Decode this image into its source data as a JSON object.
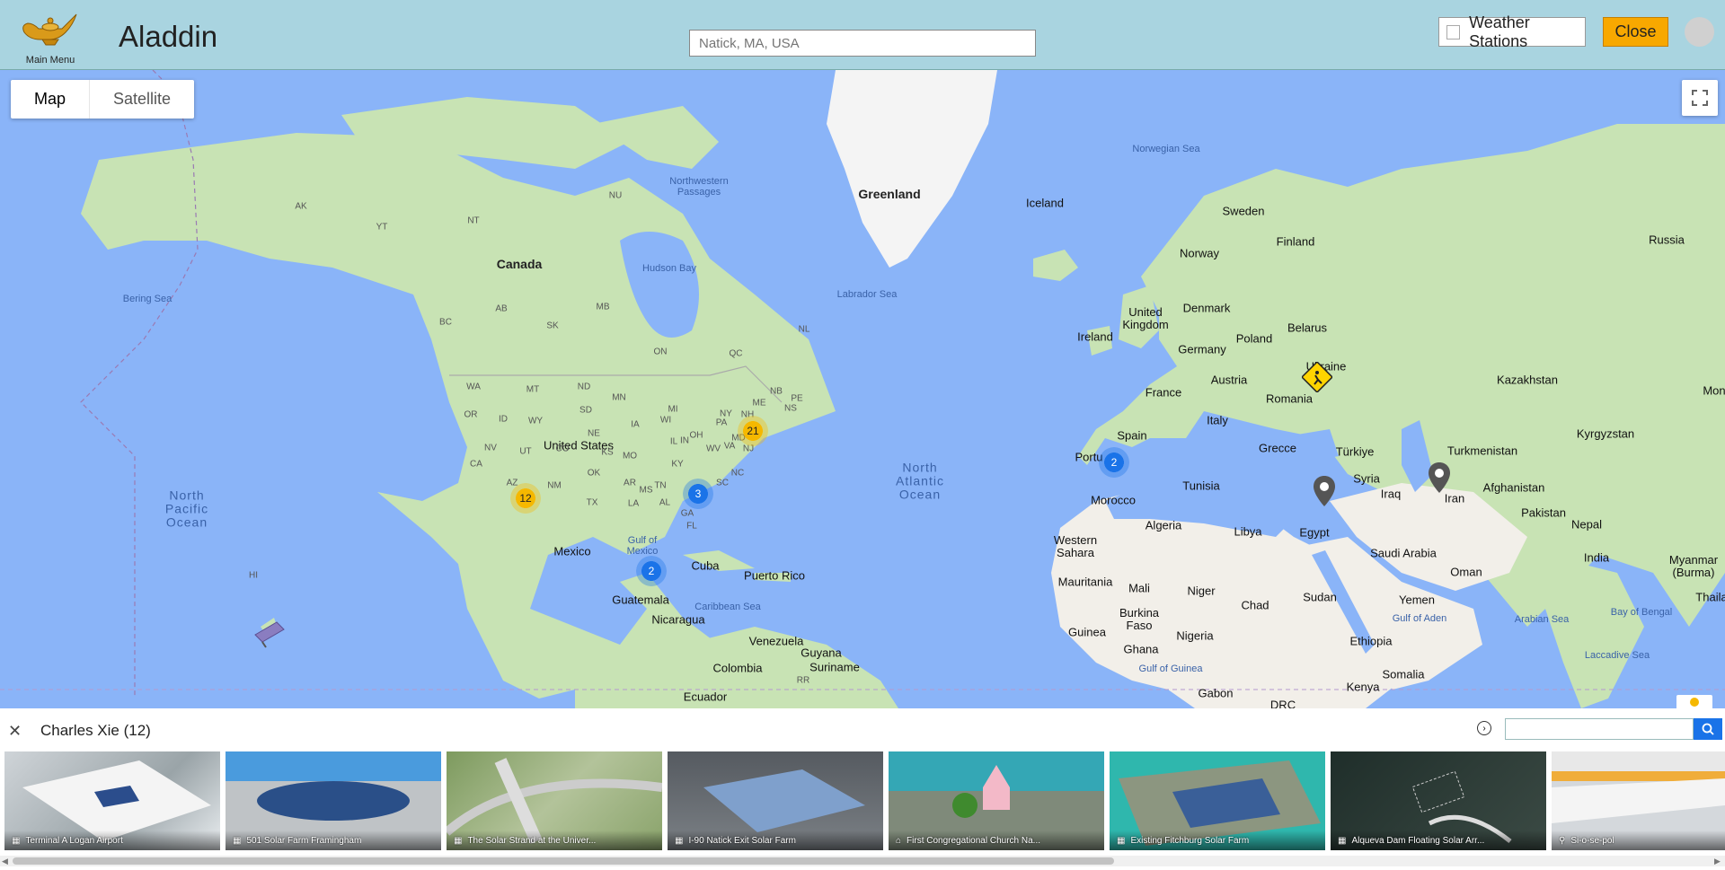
{
  "header": {
    "menu_label": "Main Menu",
    "app_title": "Aladdin",
    "search_placeholder": "Natick, MA, USA",
    "weather_label": "Weather Stations",
    "close_label": "Close"
  },
  "map": {
    "type_buttons": [
      "Map",
      "Satellite"
    ],
    "labels": {
      "greenland": "Greenland",
      "iceland": "Iceland",
      "canada": "Canada",
      "hudson_bay": "Hudson Bay",
      "nw_passages": "Northwestern\nPassages",
      "labrador_sea": "Labrador Sea",
      "bering_sea": "Bering Sea",
      "norwegian_sea": "Norwegian Sea",
      "united_states": "United States",
      "mexico": "Mexico",
      "cuba": "Cuba",
      "puerto_rico": "Puerto Rico",
      "guatemala": "Guatemala",
      "nicaragua": "Nicaragua",
      "gulf_of_mexico": "Gulf of\nMexico",
      "caribbean_sea": "Caribbean Sea",
      "venezuela": "Venezuela",
      "guyana": "Guyana",
      "suriname": "Suriname",
      "colombia": "Colombia",
      "ecuador": "Ecuador",
      "north_pacific": "North\nPacific\nOcean",
      "north_atlantic": "North\nAtlantic\nOcean",
      "sweden": "Sweden",
      "finland": "Finland",
      "norway": "Norway",
      "russia": "Russia",
      "united_kingdom": "United\nKingdom",
      "ireland": "Ireland",
      "denmark": "Denmark",
      "poland": "Poland",
      "belarus": "Belarus",
      "germany": "Germany",
      "ukraine": "Ukraine",
      "france": "France",
      "austria": "Austria",
      "romania": "Romania",
      "italy": "Italy",
      "spain": "Spain",
      "portugal": "Portu",
      "greece": "Grecce",
      "turkiye": "Türkiye",
      "kazakhstan": "Kazakhstan",
      "turkmenistan": "Turkmenistan",
      "kyrgyzstan": "Kyrgyzstan",
      "afghanistan": "Afghanistan",
      "pakistan": "Pakistan",
      "tunisia": "Tunisia",
      "syria": "Syria",
      "iraq": "Iraq",
      "iran": "Iran",
      "morocco": "Morocco",
      "algeria": "Algeria",
      "libya": "Libya",
      "egypt": "Egypt",
      "saudi_arabia": "Saudi Arabia",
      "oman": "Oman",
      "yemen": "Yemen",
      "western_sahara": "Western\nSahara",
      "mauritania": "Mauritania",
      "mali": "Mali",
      "niger": "Niger",
      "chad": "Chad",
      "sudan": "Sudan",
      "burkina_faso": "Burkina\nFaso",
      "guinea": "Guinea",
      "nigeria": "Nigeria",
      "ghana": "Ghana",
      "ethiopia": "Ethiopia",
      "somalia": "Somalia",
      "gulf_of_guinea": "Gulf of Guinea",
      "gulf_of_aden": "Gulf of Aden",
      "gabon": "Gabon",
      "kenya": "Kenya",
      "drc": "DRC",
      "nepal": "Nepal",
      "india": "India",
      "myanmar": "Myanmar\n(Burma)",
      "arabian_sea": "Arabian Sea",
      "bay_of_bengal": "Bay of Bengal",
      "laccadive_sea": "Laccadive Sea",
      "thailand": "Thaila",
      "mongolia": "Mon"
    },
    "state_labels": [
      "AK",
      "YT",
      "NT",
      "NU",
      "BC",
      "AB",
      "SK",
      "MB",
      "ON",
      "QC",
      "NL",
      "NB",
      "PE",
      "NS",
      "WA",
      "OR",
      "ID",
      "MT",
      "WY",
      "NV",
      "UT",
      "CA",
      "AZ",
      "NM",
      "CO",
      "ND",
      "SD",
      "NE",
      "KS",
      "OK",
      "TX",
      "MN",
      "IA",
      "MO",
      "AR",
      "LA",
      "WI",
      "IL",
      "MI",
      "IN",
      "OH",
      "KY",
      "TN",
      "MS",
      "AL",
      "GA",
      "FL",
      "PA",
      "NY",
      "WV",
      "VA",
      "NC",
      "SC",
      "MD",
      "NJ",
      "ME",
      "NH",
      "HI",
      "RR"
    ],
    "clusters": [
      {
        "count": "21",
        "color": "yellow"
      },
      {
        "count": "12",
        "color": "yellow"
      },
      {
        "count": "3",
        "color": "blue"
      },
      {
        "count": "2",
        "color": "blue"
      },
      {
        "count": "2",
        "color": "blue"
      }
    ]
  },
  "panel": {
    "title": "Charles Xie (12)",
    "help_glyph": "›",
    "items": [
      {
        "label": "Terminal A Logan Airport",
        "icon": "solar-panel-icon"
      },
      {
        "label": "501 Solar Farm Framingham",
        "icon": "solar-panel-icon"
      },
      {
        "label": "The Solar Strand at the Univer...",
        "icon": "solar-panel-icon"
      },
      {
        "label": "I-90 Natick Exit Solar Farm",
        "icon": "solar-panel-icon"
      },
      {
        "label": "First Congregational Church Na...",
        "icon": "building-icon"
      },
      {
        "label": "Existing Fitchburg Solar Farm",
        "icon": "solar-panel-icon"
      },
      {
        "label": "Alqueva Dam Floating Solar Arr...",
        "icon": "solar-panel-icon"
      },
      {
        "label": "Si-o-se-pol",
        "icon": "pin-icon"
      }
    ]
  },
  "colors": {
    "header_bg": "#a9d4e0",
    "close_button": "#f8a800",
    "water": "#8ab4f8",
    "land": "#c8e3b4",
    "cluster_yellow": "#f5b800",
    "cluster_blue": "#1a73e8"
  }
}
